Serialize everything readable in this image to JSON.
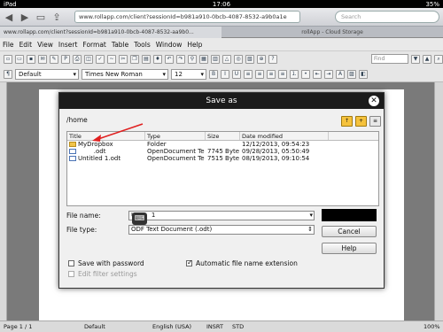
{
  "status_bar": {
    "device": "iPad",
    "time": "17:06",
    "battery": "35%"
  },
  "browser": {
    "url": "www.rollapp.com/client?sessionId=b981a910-0bcb-4087-8532-a9b0a1e",
    "search_placeholder": "Search",
    "tabs": [
      {
        "label": "www.rollapp.com/client?sessionId=b981a910-0bcb-4087-8532-aa9b0..."
      },
      {
        "label": "rollApp - Cloud Storage"
      }
    ]
  },
  "menu": {
    "items": [
      "File",
      "Edit",
      "View",
      "Insert",
      "Format",
      "Table",
      "Tools",
      "Window",
      "Help"
    ]
  },
  "toolbar": {
    "find_placeholder": "Find",
    "style": "Default",
    "font": "Times New Roman",
    "size": "12"
  },
  "dialog": {
    "title": "Save as",
    "path": "/home",
    "columns": [
      "Title",
      "Type",
      "Size",
      "Date modified"
    ],
    "files": [
      {
        "title": "MyDropbox",
        "type": "Folder",
        "size": "",
        "date": "12/12/2013, 09:54:23",
        "icon": "folder-icon"
      },
      {
        "title": "        .odt",
        "type": "OpenDocument Te",
        "size": "7745 Byte",
        "date": "09/28/2013, 05:50:49",
        "icon": "document-icon"
      },
      {
        "title": "Untitled 1.odt",
        "type": "OpenDocument Te",
        "size": "7515 Byte",
        "date": "08/19/2013, 09:10:54",
        "icon": "document-icon"
      }
    ],
    "file_name_label": "File name:",
    "file_name_value": "U        1",
    "file_type_label": "File type:",
    "file_type_value": "ODF Text Document (.odt)",
    "save_label": "",
    "cancel_label": "Cancel",
    "help_label": "Help",
    "save_with_password": "Save with password",
    "auto_extension": "Automatic file name extension",
    "edit_filter": "Edit filter settings"
  },
  "lo_status": {
    "page": "Page 1 / 1",
    "style": "Default",
    "lang": "English (USA)",
    "insert": "INSRT",
    "std": "STD",
    "zoom": "100%"
  },
  "colors": {
    "annotation_arrow": "#e02020",
    "title_bar": "#1b1b1b"
  }
}
